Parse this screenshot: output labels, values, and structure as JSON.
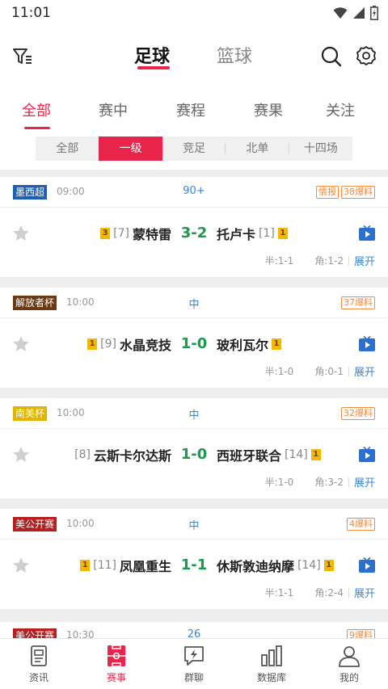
{
  "status_bar": {
    "time": "11:01"
  },
  "header": {
    "sport_tabs": [
      {
        "label": "足球"
      },
      {
        "label": "篮球"
      }
    ],
    "active_sport": "足球"
  },
  "sub_tabs": [
    {
      "label": "全部"
    },
    {
      "label": "赛中"
    },
    {
      "label": "赛程"
    },
    {
      "label": "赛果"
    },
    {
      "label": "关注"
    }
  ],
  "level_tabs": [
    {
      "label": "全部"
    },
    {
      "label": "一级"
    },
    {
      "label": "竞足"
    },
    {
      "label": "北单"
    },
    {
      "label": "十四场"
    }
  ],
  "active_level": "一级",
  "colors": {
    "accent": "#e8244a",
    "score": "#1a9a4a",
    "link": "#3a86d8",
    "tag": "#f08c42"
  },
  "matches": [
    {
      "league": "墨西超",
      "league_color": "#1f5fb0",
      "time": "09:00",
      "status": "90+",
      "tags": [
        "情报",
        "38爆料"
      ],
      "home": {
        "level": "3",
        "rank": "[7]",
        "name": "蒙特雷"
      },
      "score": "3-2",
      "away": {
        "name": "托卢卡",
        "rank": "[1]",
        "level": "1"
      },
      "half": "半:1-1",
      "corner": "角:1-2",
      "expand": "展开"
    },
    {
      "league": "解放者杯",
      "league_color": "#6b3a12",
      "time": "10:00",
      "status": "中",
      "tags": [
        "37爆料"
      ],
      "home": {
        "level": "1",
        "rank": "[9]",
        "name": "水晶竞技"
      },
      "score": "1-0",
      "away": {
        "name": "玻利瓦尔",
        "rank": "",
        "level": "1"
      },
      "half": "半:1-0",
      "corner": "角:0-1",
      "expand": "展开"
    },
    {
      "league": "南美杯",
      "league_color": "#e0b400",
      "time": "10:00",
      "status": "中",
      "tags": [
        "32爆料"
      ],
      "home": {
        "level": "",
        "rank": "[8]",
        "name": "云斯卡尔达斯"
      },
      "score": "1-0",
      "away": {
        "name": "西班牙联合",
        "rank": "[14]",
        "level": "1"
      },
      "half": "半:1-0",
      "corner": "角:3-2",
      "expand": "展开"
    },
    {
      "league": "美公开赛",
      "league_color": "#b51f1f",
      "time": "10:00",
      "status": "中",
      "tags": [
        "4爆料"
      ],
      "home": {
        "level": "1",
        "rank": "[11]",
        "name": "凤凰重生"
      },
      "score": "1-1",
      "away": {
        "name": "休斯敦迪纳摩",
        "rank": "[14]",
        "level": "1"
      },
      "half": "半:1-1",
      "corner": "角:2-4",
      "expand": "展开"
    }
  ],
  "partial_match": {
    "league": "美公开赛",
    "time": "10:30",
    "status": "26",
    "tags": [
      "9爆料"
    ]
  },
  "bottom_nav": [
    {
      "label": "资讯"
    },
    {
      "label": "赛事"
    },
    {
      "label": "群聊"
    },
    {
      "label": "数据库"
    },
    {
      "label": "我的"
    }
  ],
  "active_nav": "赛事"
}
